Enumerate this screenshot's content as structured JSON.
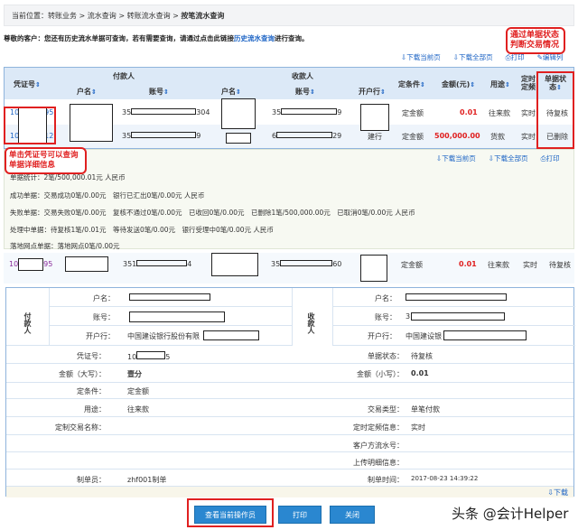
{
  "breadcrumb": {
    "prefix": "当前位置：",
    "items": [
      "转账业务",
      "流水查询",
      "转账流水查询"
    ],
    "current": "按笔流水查询",
    "sep": " > "
  },
  "notice": {
    "text": "尊敬的客户：您还有历史流水单据可查询，若有需要查询，请通过点击此链接",
    "link": "历史流水查询",
    "suffix": "进行查询。"
  },
  "annotations": {
    "status_hint": "通过单据状态判断交易情况",
    "voucher_hint": "单击凭证号可以查询单据详细信息"
  },
  "toolbar": {
    "download_page": "下载当前页",
    "download_all": "下载全部页",
    "print": "打印",
    "edit_columns": "编辑列"
  },
  "table": {
    "group_payer": "付款人",
    "group_payee": "收款人",
    "headers": {
      "voucher": "凭证号",
      "payer_name": "户名",
      "payer_account": "账号",
      "payee_name": "户名",
      "payee_account": "账号",
      "payee_bank": "开户行",
      "condition": "定条件",
      "amount": "金额(元)",
      "usage": "用途",
      "timing": "定时定频",
      "status": "单据状态"
    },
    "rows": [
      {
        "voucher_pre": "10",
        "voucher_suf": "95",
        "payer_acc_pre": "35",
        "payer_acc_suf": "304",
        "payee_acc_pre": "35",
        "payee_acc_suf": "9",
        "payee_bank": "",
        "condition": "定金额",
        "amount": "0.01",
        "usage": "往来款",
        "timing": "实时",
        "status": "待复核"
      },
      {
        "voucher_pre": "10",
        "voucher_suf": "12",
        "payer_acc_pre": "35",
        "payer_acc_suf": "9",
        "payee_acc_pre": "6",
        "payee_acc_suf": "29",
        "payee_bank": "建行",
        "condition": "定金额",
        "amount": "500,000.00",
        "usage": "货款",
        "timing": "实时",
        "status": "已删除"
      }
    ]
  },
  "summary": {
    "lines": [
      "单据统计：2笔/500,000.01元 人民币",
      "成功单据：交易成功0笔/0.00元　银行已汇出0笔/0.00元 人民币",
      "失败单据：交易失败0笔/0.00元　复核不通过0笔/0.00元　已收回0笔/0.00元　已删除1笔/500,000.00元　已取消0笔/0.00元 人民币",
      "处理中单据：待复核1笔/0.01元　等待发送0笔/0.00元　银行受理中0笔/0.00元 人民币",
      "落地网点单据：落地网点0笔/0.00元"
    ]
  },
  "single_row": {
    "voucher_pre": "10",
    "voucher_suf": "95",
    "payer_acc_pre": "351",
    "payer_acc_suf": "4",
    "payee_acc_pre": "35",
    "payee_acc_suf": "60",
    "condition": "定金额",
    "amount": "0.01",
    "usage": "往来款",
    "timing": "实时",
    "status": "待复核"
  },
  "detail": {
    "payer_label": "付款人",
    "payee_label": "收款人",
    "name_label": "户名：",
    "account_label": "账号：",
    "bank_label": "开户行：",
    "payer_bank": "中国建设银行股份有限",
    "payee_account_pre": "3",
    "payee_bank": "中国建设银",
    "voucher_label": "凭证号：",
    "voucher_pre": "10",
    "voucher_suf": "5",
    "status_label": "单据状态：",
    "status": "待复核",
    "amount_upper_label": "金额（大写）：",
    "amount_upper": "壹分",
    "amount_lower_label": "金额（小写）：",
    "amount_lower": "0.01",
    "condition_label": "定条件：",
    "condition": "定金额",
    "usage_label": "用途：",
    "usage": "往来款",
    "type_label": "交易类型：",
    "type": "单笔付款",
    "custom_label": "定制交易名称：",
    "timing_label": "定时定频信息：",
    "timing": "实时",
    "serial_label": "客户方流水号：",
    "upload_label": "上传明细信息：",
    "maker_label": "制单员：",
    "maker": "zhf001制单",
    "time_label": "制单时间：",
    "time": "2017-08-23 14:39:22",
    "download": "下载"
  },
  "buttons": {
    "view_operator": "查看当前操作员",
    "print": "打印",
    "close": "关闭"
  },
  "watermark": "头条 @会计Helper"
}
